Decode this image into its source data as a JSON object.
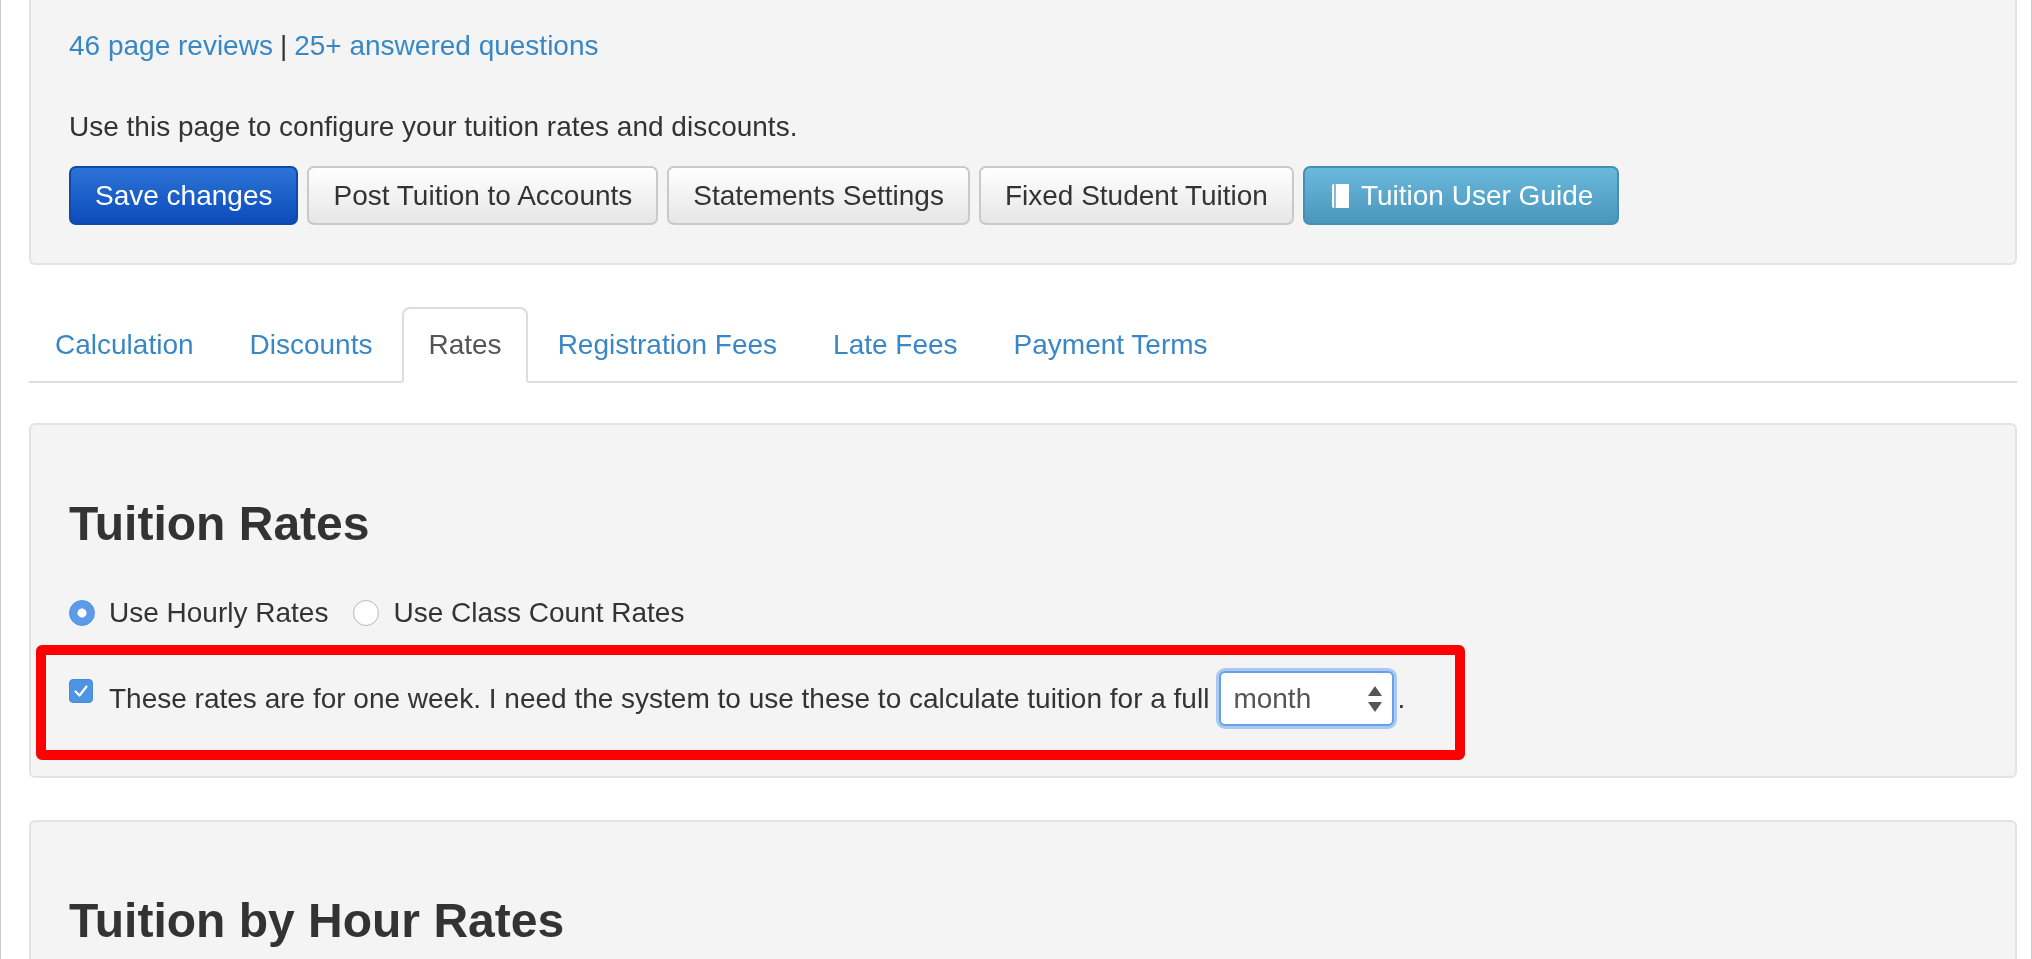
{
  "header": {
    "links": [
      "46 page reviews",
      "25+ answered questions"
    ],
    "separator": "|",
    "description": "Use this page to configure your tuition rates and discounts.",
    "buttons": [
      {
        "label": "Save changes",
        "kind": "primary"
      },
      {
        "label": "Post Tuition to Accounts",
        "kind": "default"
      },
      {
        "label": "Statements Settings",
        "kind": "default"
      },
      {
        "label": "Fixed Student Tuition",
        "kind": "default"
      },
      {
        "label": "Tuition User Guide",
        "kind": "info"
      }
    ]
  },
  "tabs": [
    {
      "label": "Calculation",
      "selected": false
    },
    {
      "label": "Discounts",
      "selected": false
    },
    {
      "label": "Rates",
      "selected": true
    },
    {
      "label": "Registration Fees",
      "selected": false
    },
    {
      "label": "Late Fees",
      "selected": false
    },
    {
      "label": "Payment Terms",
      "selected": false
    }
  ],
  "rates": {
    "title": "Tuition Rates",
    "options": [
      {
        "label": "Use Hourly Rates",
        "selected": true
      },
      {
        "label": "Use Class Count Rates",
        "selected": false
      }
    ],
    "weekly_setting": {
      "checked": true,
      "text": "These rates are for one week. I need the system to use these to calculate tuition for a full",
      "period": {
        "value": "month",
        "focused": true
      },
      "suffix": ".",
      "highlighted": true
    }
  },
  "hour_rates": {
    "title": "Tuition by Hour Rates"
  }
}
